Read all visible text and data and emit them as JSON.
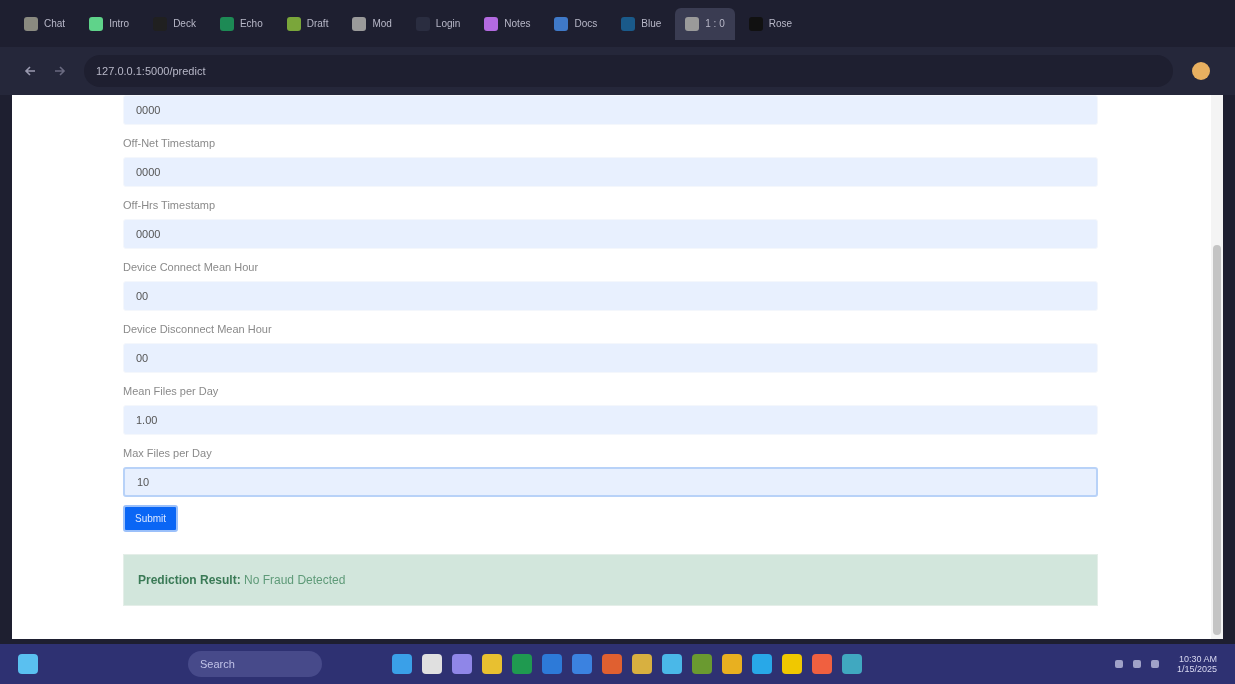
{
  "browser": {
    "tabs": [
      {
        "title": "Chat",
        "color": "#8a8a80",
        "selected": false
      },
      {
        "title": "Intro",
        "color": "#5fd38a",
        "selected": false
      },
      {
        "title": "Deck",
        "color": "#202020",
        "selected": false
      },
      {
        "title": "Echo",
        "color": "#1d8a55",
        "selected": false
      },
      {
        "title": "Draft",
        "color": "#7aa63a",
        "selected": false
      },
      {
        "title": "Mod",
        "color": "#9a9a9a",
        "selected": false
      },
      {
        "title": "Login",
        "color": "#2a2d40",
        "selected": false
      },
      {
        "title": "Notes",
        "color": "#b36ae0",
        "selected": false
      },
      {
        "title": "Docs",
        "color": "#3f79c8",
        "selected": false
      },
      {
        "title": "Blue",
        "color": "#1a5a8a",
        "selected": false
      },
      {
        "title": "1 : 0",
        "color": "#9a9a9a",
        "selected": true
      },
      {
        "title": "Rose",
        "color": "#111111",
        "selected": false
      }
    ],
    "address": "127.0.0.1:5000/predict"
  },
  "form": {
    "fields": [
      {
        "value": "0000",
        "focused": false
      },
      {
        "label": "Off-Net Timestamp",
        "value": "0000",
        "focused": false
      },
      {
        "label": "Off-Hrs Timestamp",
        "value": "0000",
        "focused": false
      },
      {
        "label": "Device Connect Mean Hour",
        "value": "00",
        "focused": false
      },
      {
        "label": "Device Disconnect Mean Hour",
        "value": "00",
        "focused": false
      },
      {
        "label": "Mean Files per Day",
        "value": "1.00",
        "focused": false
      },
      {
        "label": "Max Files per Day",
        "value": "10",
        "focused": true
      }
    ],
    "submit": "Submit",
    "result": "**Prediction Result:** No Fraud Detected"
  },
  "taskbar": {
    "search": "Search",
    "apps": [
      {
        "color": "#3aa0e8"
      },
      {
        "color": "#e0e0e0"
      },
      {
        "color": "#8f86e8"
      },
      {
        "color": "#e8c030"
      },
      {
        "color": "#1f9a50"
      },
      {
        "color": "#2d7ad8"
      },
      {
        "color": "#3b82e0"
      },
      {
        "color": "#e06030"
      },
      {
        "color": "#d8b040"
      },
      {
        "color": "#4ab8e8"
      },
      {
        "color": "#6a9a30"
      },
      {
        "color": "#e8b020"
      },
      {
        "color": "#28a8e8"
      },
      {
        "color": "#f0c800"
      },
      {
        "color": "#f06040"
      },
      {
        "color": "#40a8c0"
      }
    ],
    "time": "10:30 AM",
    "date": "1/15/2025"
  }
}
